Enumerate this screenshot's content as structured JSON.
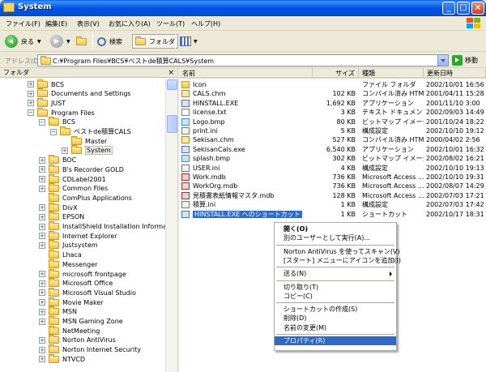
{
  "window": {
    "title": "System"
  },
  "title_buttons": {
    "minimize": "_",
    "maximize": "□",
    "close": "×"
  },
  "menu": [
    "ファイル(F)",
    "編集(E)",
    "表示(V)",
    "お気に入り(A)",
    "ツール(T)",
    "ヘルプ(H)"
  ],
  "toolbar": {
    "back": "戻る",
    "search": "検索",
    "folders": "フォルダ"
  },
  "address": {
    "label": "アドレス(D)",
    "path": "C:¥Program Files¥BCS¥ベストde積算CALS¥System",
    "go": "移動"
  },
  "folder_pane": {
    "header": "フォルダ",
    "close": "×",
    "items": [
      {
        "label": "BCS",
        "level": 1,
        "pm": "+"
      },
      {
        "label": "Documents and Settings",
        "level": 1,
        "pm": "+"
      },
      {
        "label": "JUST",
        "level": 1,
        "pm": "+"
      },
      {
        "label": "Program Files",
        "level": 1,
        "pm": "−"
      },
      {
        "label": "BCS",
        "level": 2,
        "pm": "−"
      },
      {
        "label": "ベストde積算CALS",
        "level": 3,
        "pm": "−"
      },
      {
        "label": "Master",
        "level": 4,
        "pm": ""
      },
      {
        "label": "System",
        "level": 4,
        "pm": "+"
      },
      {
        "label": "BOC",
        "level": 2,
        "pm": "+"
      },
      {
        "label": "B's Recorder GOLD",
        "level": 2,
        "pm": "+"
      },
      {
        "label": "CDLabel2001",
        "level": 2,
        "pm": "+"
      },
      {
        "label": "Common Files",
        "level": 2,
        "pm": "+"
      },
      {
        "label": "ComPlus Applications",
        "level": 2,
        "pm": ""
      },
      {
        "label": "DivX",
        "level": 2,
        "pm": "+"
      },
      {
        "label": "EPSON",
        "level": 2,
        "pm": "+"
      },
      {
        "label": "InstallShield Installation Information",
        "level": 2,
        "pm": "+"
      },
      {
        "label": "Internet Explorer",
        "level": 2,
        "pm": "+"
      },
      {
        "label": "Justsystem",
        "level": 2,
        "pm": "+"
      },
      {
        "label": "Lhaca",
        "level": 2,
        "pm": ""
      },
      {
        "label": "Messenger",
        "level": 2,
        "pm": ""
      },
      {
        "label": "microsoft frontpage",
        "level": 2,
        "pm": "+"
      },
      {
        "label": "Microsoft Office",
        "level": 2,
        "pm": "+"
      },
      {
        "label": "Microsoft Visual Studio",
        "level": 2,
        "pm": "+"
      },
      {
        "label": "Movie Maker",
        "level": 2,
        "pm": "+"
      },
      {
        "label": "MSN",
        "level": 2,
        "pm": "+"
      },
      {
        "label": "MSN Gaming Zone",
        "level": 2,
        "pm": "+"
      },
      {
        "label": "NetMeeting",
        "level": 2,
        "pm": ""
      },
      {
        "label": "Norton AntiVirus",
        "level": 2,
        "pm": "+"
      },
      {
        "label": "Norton Internet Security",
        "level": 2,
        "pm": "+"
      },
      {
        "label": "NTVCD",
        "level": 2,
        "pm": "+"
      }
    ]
  },
  "columns": {
    "name": "名前",
    "size": "サイズ",
    "type": "種類",
    "date": "更新日時"
  },
  "files": [
    {
      "name": "Icon",
      "size": "",
      "type": "ファイル フォルダ",
      "date": "2002/10/01 16:56",
      "icon": "folder"
    },
    {
      "name": "CALS.chm",
      "size": "102 KB",
      "type": "コンパイル済み HTM...",
      "date": "2001/04/11 15:28",
      "icon": "chm"
    },
    {
      "name": "HINSTALL.EXE",
      "size": "1,692 KB",
      "type": "アプリケーション",
      "date": "2001/11/10 3:00",
      "icon": "exe"
    },
    {
      "name": "license.txt",
      "size": "3 KB",
      "type": "テキスト ドキュメント",
      "date": "2002/09/03 14:49",
      "icon": "doc"
    },
    {
      "name": "Logo.bmp",
      "size": "80 KB",
      "type": "ビットマップ イメージ",
      "date": "2001/10/24 18:22",
      "icon": "bmp"
    },
    {
      "name": "print.ini",
      "size": "5 KB",
      "type": "構成設定",
      "date": "2002/10/10 19:12",
      "icon": "ini"
    },
    {
      "name": "Sekisan.chm",
      "size": "527 KB",
      "type": "コンパイル済み HTM...",
      "date": "2000/04/02 2:56",
      "icon": "chm"
    },
    {
      "name": "SekisanCals.exe",
      "size": "6,540 KB",
      "type": "アプリケーション",
      "date": "2002/10/01 16:32",
      "icon": "exe"
    },
    {
      "name": "splash.bmp",
      "size": "302 KB",
      "type": "ビットマップ イメージ",
      "date": "2002/08/02 16:21",
      "icon": "bmp"
    },
    {
      "name": "USER.ini",
      "size": "4 KB",
      "type": "構成設定",
      "date": "2002/10/10 19:13",
      "icon": "ini"
    },
    {
      "name": "Work.mdb",
      "size": "736 KB",
      "type": "Microsoft Access ...",
      "date": "2002/10/10 19:31",
      "icon": "mdb"
    },
    {
      "name": "WorkOrg.mdb",
      "size": "736 KB",
      "type": "Microsoft Access ...",
      "date": "2002/08/07 14:29",
      "icon": "mdb"
    },
    {
      "name": "見積書表紙情報マスタ.mdb",
      "size": "128 KB",
      "type": "Microsoft Access ...",
      "date": "2002/07/03 17:21",
      "icon": "mdb"
    },
    {
      "name": "積算.ini",
      "size": "1 KB",
      "type": "構成設定",
      "date": "2002/07/03 17:42",
      "icon": "ini"
    },
    {
      "name": "HINSTALL.EXE へのショートカット",
      "size": "1 KB",
      "type": "ショートカット",
      "date": "2002/10/17 18:31",
      "icon": "lnk",
      "selected": true
    }
  ],
  "context_menu": [
    {
      "label": "開く(O)",
      "bold": true
    },
    {
      "label": "別のユーザーとして実行(A)..."
    },
    {
      "sep": true
    },
    {
      "label": "Norton AntiVirus を使ってスキャン(V)"
    },
    {
      "label": "[スタート] メニューにアイコンを追加(I)"
    },
    {
      "sep": true
    },
    {
      "label": "送る(N)",
      "submenu": true
    },
    {
      "sep": true
    },
    {
      "label": "切り取り(T)"
    },
    {
      "label": "コピー(C)"
    },
    {
      "sep": true
    },
    {
      "label": "ショートカットの作成(S)"
    },
    {
      "label": "削除(D)"
    },
    {
      "label": "名前の変更(M)"
    },
    {
      "sep": true
    },
    {
      "label": "プロパティ(R)",
      "highlighted": true
    }
  ]
}
